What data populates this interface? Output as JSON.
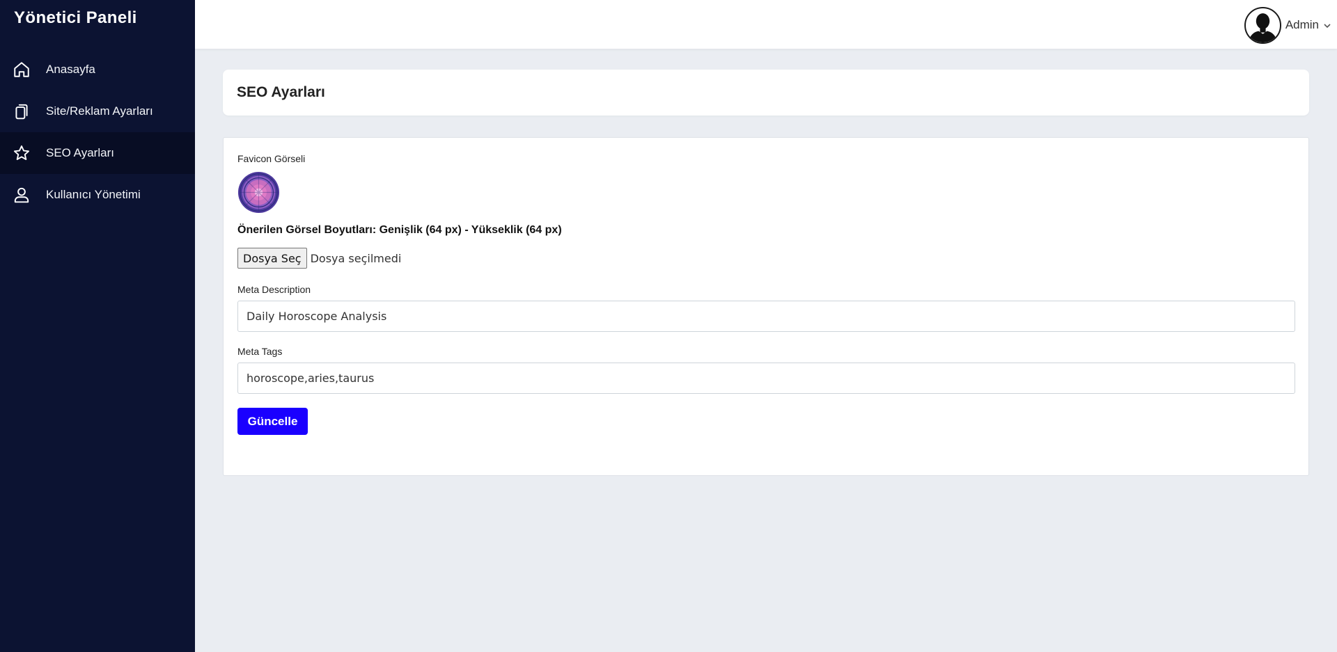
{
  "sidebar": {
    "brand": "Yönetici Paneli",
    "items": [
      {
        "label": "Anasayfa",
        "icon": "home-icon",
        "active": false
      },
      {
        "label": "Site/Reklam Ayarları",
        "icon": "copy-icon",
        "active": false
      },
      {
        "label": "SEO Ayarları",
        "icon": "star-icon",
        "active": true
      },
      {
        "label": "Kullanıcı Yönetimi",
        "icon": "user-icon",
        "active": false
      }
    ]
  },
  "topbar": {
    "user_name": "Admin",
    "avatar_icon": "user-silhouette-icon",
    "menu_icon": "chevron-down-icon"
  },
  "page": {
    "title": "SEO Ayarları"
  },
  "form": {
    "favicon_label": "Favicon Görseli",
    "size_note": "Önerilen Görsel Boyutları: Genişlik (64 px) - Yükseklik (64 px)",
    "file_button": "Dosya Seç",
    "file_status": "Dosya seçilmedi",
    "meta_description_label": "Meta Description",
    "meta_description_value": "Daily Horoscope Analysis",
    "meta_tags_label": "Meta Tags",
    "meta_tags_value": "horoscope,aries,taurus",
    "submit_label": "Güncelle"
  },
  "colors": {
    "sidebar_bg": "#0c1332",
    "sidebar_active_bg": "#080d24",
    "page_bg": "#eaedf2",
    "primary_button": "#1a00ff"
  }
}
